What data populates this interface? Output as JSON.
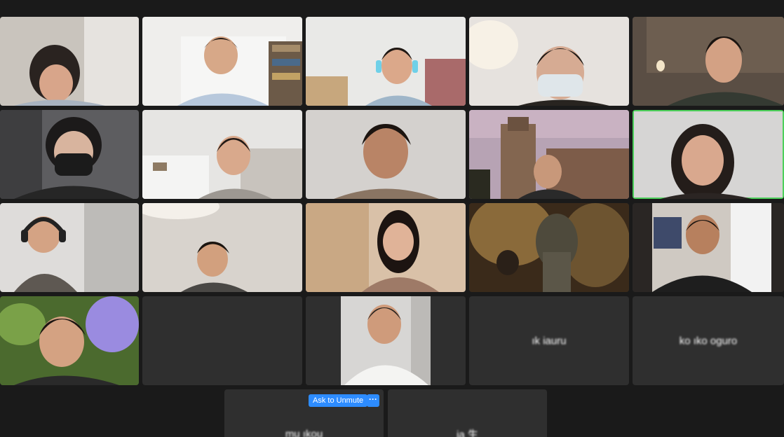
{
  "participants": {
    "name_1": "ık  iauru",
    "name_2": "ko  ıko  oguro",
    "name_3": "mu  ıkou",
    "name_4": "ja  生"
  },
  "controls": {
    "ask_to_unmute": "Ask to Unmute",
    "more": "···"
  },
  "colors": {
    "background": "#1a1a1a",
    "tile": "#2f2f2f",
    "active_speaker_border": "#4cd05a",
    "button": "#2d8cff"
  }
}
